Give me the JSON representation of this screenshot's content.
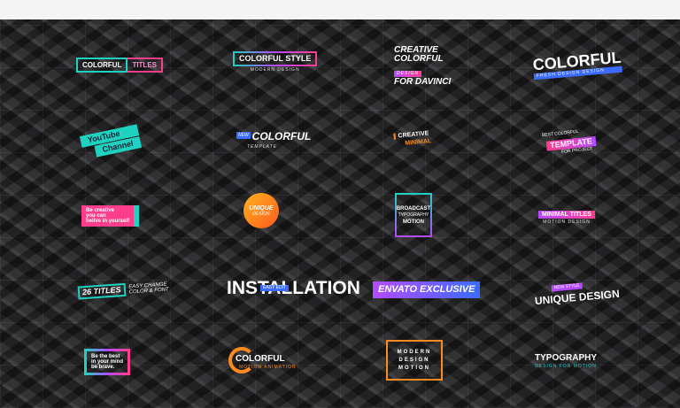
{
  "items": {
    "colorful_titles": {
      "a": "COLORFUL",
      "b": "TITLES"
    },
    "colorful_style": {
      "title": "COLORFUL STYLE",
      "sub": "MODERN DESIGN"
    },
    "creative_colorful": {
      "l1": "CREATIVE",
      "l2": "COLORFUL",
      "l3": "DESIGN",
      "l4": "FOR DAVINCI"
    },
    "colorful_big": {
      "title": "COLORFUL",
      "sub": "FRESH DESIGN DESIGN"
    },
    "youtube": {
      "l1": "YouTube",
      "l2": "Channel"
    },
    "colorful_italic": {
      "badge": "NEW",
      "title": "COLORFUL",
      "sub": "TEMPLATE"
    },
    "creative_minimal": {
      "l1": "CREATIVE",
      "l2": "MINIMAL"
    },
    "best_template": {
      "l1": "BEST COLORFUL",
      "l2": "TEMPLATE",
      "l3": "FOR PROJECT"
    },
    "be_creative": {
      "l1": "Be creative",
      "l2": "you can",
      "l3": "belive in yourself"
    },
    "unique_circle": {
      "l1": "UNIQUE",
      "l2": "DESIGN"
    },
    "broadcast": {
      "l1": "BROADCAST",
      "l2": "TYPOGRAPHY",
      "l3": "MOTION"
    },
    "minimal_titles": {
      "title": "MINIMAL TITLES",
      "sub": "MOTION DESIGN"
    },
    "titles_26": {
      "a": "26 TITLES",
      "b1": "EASY CHANGE",
      "b2": "COLOR & FONT"
    },
    "installation": {
      "title": "INSTALLATION",
      "tag": "EASY EDIT"
    },
    "envato": {
      "title": "ENVATO EXCLUSIVE"
    },
    "unique_design": {
      "badge": "NEW STYLE",
      "title": "UNIQUE DESIGN"
    },
    "be_the_best": {
      "l1": "Be the best",
      "l2": "in your mind",
      "l3": "be brave."
    },
    "colorful_ring": {
      "title": "COLORFUL",
      "sub": "MOTION ANIMATION"
    },
    "modern_design": {
      "l1": "MODERN",
      "l2": "DESIGN",
      "l3": "MOTION"
    },
    "typography": {
      "title": "TYPOGRAPHY",
      "sub": "DESIGN FOR MOTION"
    }
  },
  "colors": {
    "cyan": "#1fd1c1",
    "magenta": "#ff3d8b",
    "purple": "#b44bff",
    "orange": "#ff8a1f",
    "blue": "#3b6cff"
  }
}
